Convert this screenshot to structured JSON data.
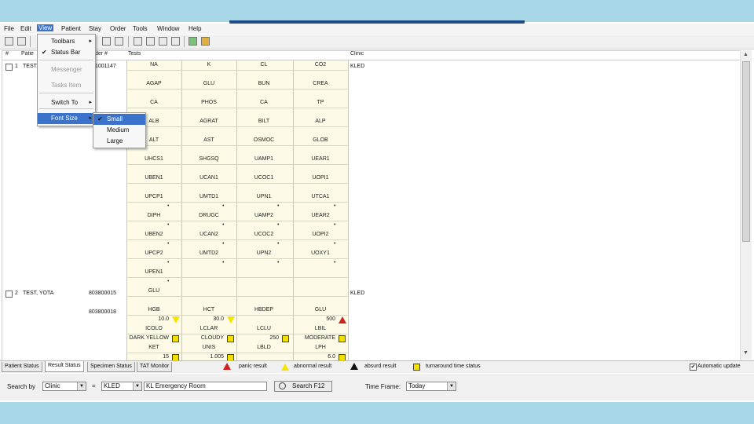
{
  "menubar": {
    "items": [
      "File",
      "Edit",
      "View",
      "Patient",
      "Stay",
      "Order",
      "Tools",
      "Window",
      "Help"
    ]
  },
  "columns": {
    "num": "#",
    "patient": "Patie",
    "order": "der #",
    "tests": "Tests",
    "clinic": "Clinic"
  },
  "rows": [
    {
      "num": "1",
      "patient": "TEST,",
      "order": "1001147",
      "clinic": "KLED"
    },
    {
      "num": "2",
      "patient": "TEST, YOTA",
      "order": "803800015",
      "clinic": "KLED",
      "order2": "803800018"
    }
  ],
  "tests": {
    "rows": [
      [
        "NA",
        "K",
        "CL",
        "CO2"
      ],
      [
        "AGAP",
        "GLU",
        "BUN",
        "CREA"
      ],
      [
        "CA",
        "PHOS",
        "CA",
        "TP"
      ],
      [
        "ALB",
        "AGRAT",
        "BILT",
        "ALP"
      ],
      [
        "ALT",
        "AST",
        "OSMOC",
        "GLOB"
      ],
      [
        "UHCS1",
        "SHGSQ",
        "UAMP1",
        "UEAR1"
      ],
      [
        "UBEN1",
        "UCAN1",
        "UCOC1",
        "UOPI1"
      ],
      [
        "UPCP1",
        "UMTD1",
        "UPN1",
        "UTCA1"
      ],
      [
        "DIPH",
        "DRUGC",
        "UAMP2",
        "UEAR2"
      ],
      [
        "UBEN2",
        "UCAN2",
        "UCOC2",
        "UOPI2"
      ],
      [
        "UPCP2",
        "UMTD2",
        "UPN2",
        "UOXY1"
      ],
      [
        "UPEN1",
        "",
        "",
        ""
      ],
      [
        "GLU",
        "",
        "",
        ""
      ],
      [
        "HGB",
        "HCT",
        "HBDEP",
        "GLU"
      ],
      [
        "ICOLO",
        "LCLAR",
        "LCLU",
        "LBIL"
      ],
      [
        "KET",
        "UNIS",
        "LBLD",
        "LPH"
      ]
    ],
    "values": [
      {
        "r": 14,
        "c": 0,
        "v": "10.0"
      },
      {
        "r": 14,
        "c": 1,
        "v": "30.0"
      },
      {
        "r": 14,
        "c": 3,
        "v": "500"
      },
      {
        "r": 15,
        "c": 0,
        "v": "DARK YELLOW"
      },
      {
        "r": 15,
        "c": 1,
        "v": "CLOUDY"
      },
      {
        "r": 15,
        "c": 2,
        "v": "250"
      },
      {
        "r": 15,
        "c": 3,
        "v": "MODERATE"
      },
      {
        "r": 16,
        "c": 0,
        "v": "15"
      },
      {
        "r": 16,
        "c": 1,
        "v": "1.005"
      },
      {
        "r": 16,
        "c": 3,
        "v": "6.0"
      }
    ]
  },
  "view_menu": {
    "items": [
      {
        "label": "Toolbars",
        "arrow": "▸",
        "check": "",
        "disabled": false
      },
      {
        "label": "Status Bar",
        "arrow": "",
        "check": "✔",
        "disabled": false
      },
      {
        "label": "Messenger",
        "arrow": "",
        "check": "",
        "disabled": true
      },
      {
        "label": "Tasks Item",
        "arrow": "",
        "check": "",
        "disabled": true
      },
      {
        "label": "Switch To",
        "arrow": "▸",
        "check": "",
        "disabled": false
      },
      {
        "label": "Font Size",
        "arrow": "▸",
        "check": "",
        "disabled": false
      }
    ]
  },
  "font_menu": {
    "items": [
      {
        "label": "Small",
        "check": "✔"
      },
      {
        "label": "Medium",
        "check": ""
      },
      {
        "label": "Large",
        "check": ""
      }
    ]
  },
  "tabs": [
    "Patient Status",
    "Result Status",
    "Specimen Status",
    "TAT Monitor"
  ],
  "legend": {
    "panic": "panic result",
    "abnormal": "abnormal result",
    "absurd": "absurd result",
    "turnaround": "turnaround time status",
    "auto_update": "Automatic update",
    "auto_update_check": "✔"
  },
  "search": {
    "search_by_label": "Search by",
    "search_by_value": "Clinic",
    "dash": "=",
    "clinic_code": "KLED",
    "clinic_name": "KL Emergency Room",
    "search_button": "Search F12",
    "time_frame_label": "Time Frame:",
    "time_frame_value": "Today"
  },
  "colors": {
    "menu_highlight": "#3a73c9",
    "panic": "#d12020",
    "abnormal": "#f5e400",
    "tests_bg": "#fdfbe8",
    "background": "#a8d8e8"
  }
}
